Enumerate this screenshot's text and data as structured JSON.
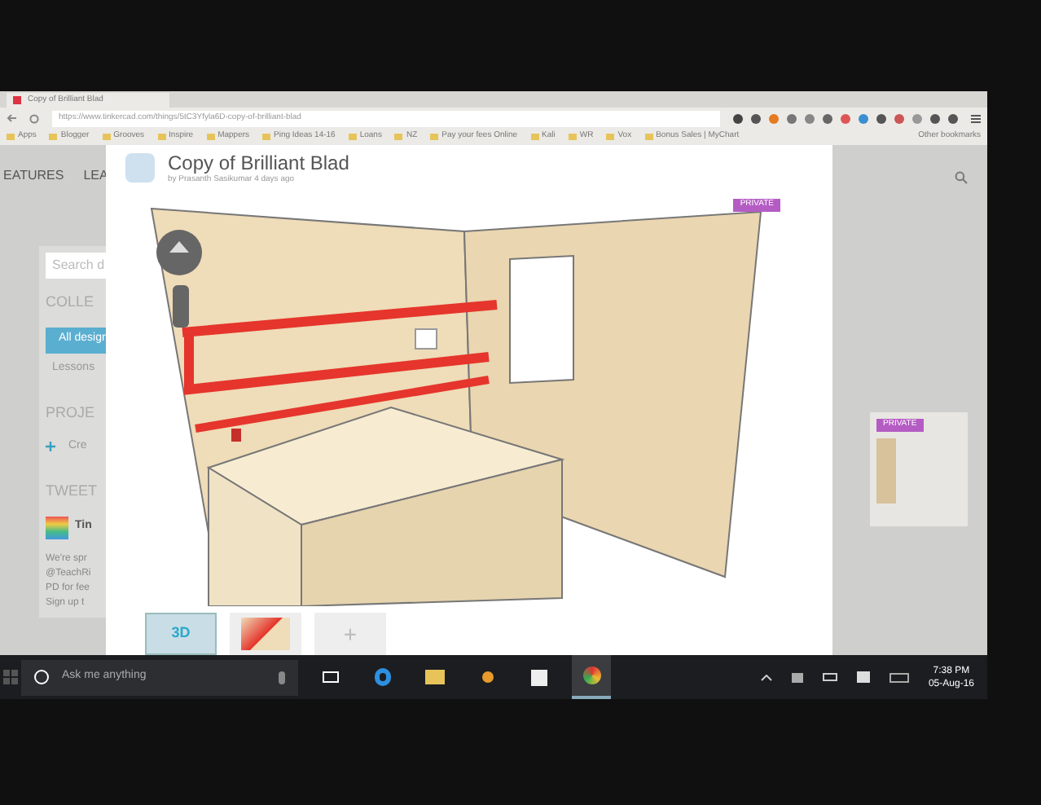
{
  "browser": {
    "tab_title": "Copy of Brilliant Blad",
    "url": "https://www.tinkercad.com/things/5tC3Yfyla6D-copy-of-brilliant-blad",
    "bookmarks": [
      "Apps",
      "Blogger",
      "Grooves",
      "Inspire",
      "Mappers",
      "Ping Ideas 14-16",
      "Loans",
      "NZ",
      "Pay your fees Online",
      "Kali",
      "WR",
      "Vox",
      "Bonus Sales | MyChart"
    ],
    "other_bookmarks": "Other bookmarks"
  },
  "page": {
    "nav": [
      "EATURES",
      "LEA"
    ],
    "search_placeholder": "Search d",
    "collections_heading": "COLLE",
    "collections": [
      {
        "label": "All design",
        "selected": true
      },
      {
        "label": "Lessons",
        "selected": false
      }
    ],
    "projects_heading": "PROJE",
    "create_label": "Cre",
    "tweets_heading": "TWEET",
    "tweet_author": "Tin",
    "tweet_lines": [
      "We're spr",
      "@TeachRi",
      "PD for fee",
      "Sign up t"
    ],
    "card_badge": "PRIVATE"
  },
  "modal": {
    "title": "Copy of Brilliant Blad",
    "byline": "by Prasanth Sasikumar 4 days ago",
    "badge": "PRIVATE",
    "thumbnails": [
      {
        "kind": "model",
        "label": "3D",
        "selected": true
      },
      {
        "kind": "image",
        "selected": false
      },
      {
        "kind": "add",
        "label": "+",
        "selected": false
      }
    ]
  },
  "taskbar": {
    "search_placeholder": "Ask me anything",
    "apps": [
      {
        "kind": "taskview",
        "selected": false
      },
      {
        "kind": "edge",
        "selected": false
      },
      {
        "kind": "explorer",
        "selected": false
      },
      {
        "kind": "app",
        "selected": false
      },
      {
        "kind": "store",
        "selected": false
      },
      {
        "kind": "chrome",
        "selected": true
      }
    ],
    "time": "7:38 PM",
    "date": "05-Aug-16"
  }
}
